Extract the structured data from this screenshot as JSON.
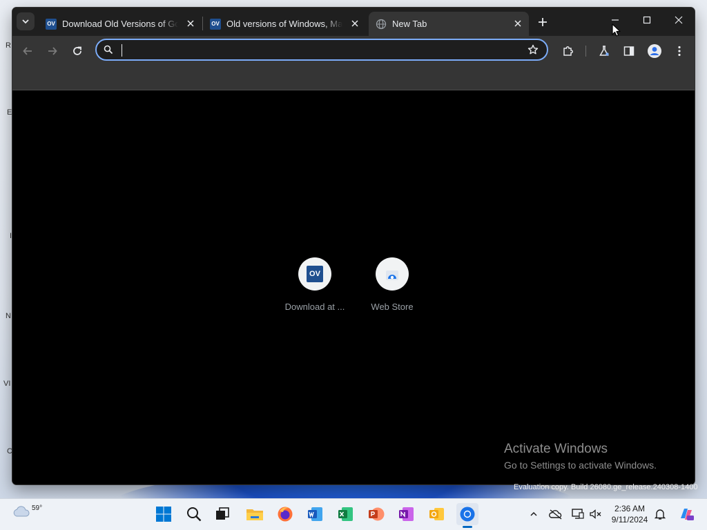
{
  "desktop": {
    "left_edge_fragments": [
      "R",
      "E",
      "I",
      "N",
      "VI",
      "C"
    ]
  },
  "browser": {
    "tabs": [
      {
        "title": "Download Old Versions of Google",
        "favicon": "OV",
        "active": false
      },
      {
        "title": "Old versions of Windows, Mac",
        "favicon": "OV",
        "active": false
      },
      {
        "title": "New Tab",
        "favicon": "globe-icon",
        "active": true
      }
    ],
    "omnibox": {
      "value": "",
      "placeholder": ""
    },
    "shortcuts": [
      {
        "label": "Download at ...",
        "icon": "OV"
      },
      {
        "label": "Web Store",
        "icon": "web-store-icon"
      }
    ]
  },
  "watermark": {
    "title": "Activate Windows",
    "subtitle": "Go to Settings to activate Windows.",
    "eval": "Evaluation copy. Build 26080.ge_release.240308-1400"
  },
  "taskbar": {
    "weather_temp": "59°",
    "time": "2:36 AM",
    "date": "9/11/2024",
    "apps": [
      "start",
      "search",
      "task-view",
      "file-explorer",
      "firefox",
      "word",
      "excel",
      "powerpoint",
      "onenote",
      "outlook",
      "chrome"
    ]
  },
  "colors": {
    "accent": "#7cacf8",
    "tabstrip": "#1f1f1f",
    "toolbar": "#353535",
    "ntp_background": "#000000",
    "taskbar": "#eef2f7"
  }
}
